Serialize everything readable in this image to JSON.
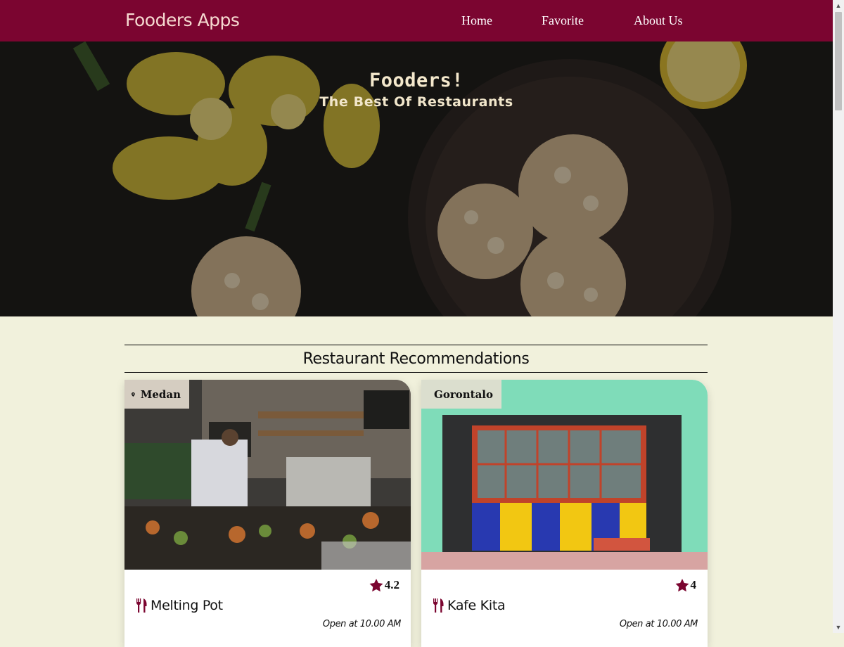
{
  "navbar": {
    "brand": "Fooders Apps",
    "links": [
      {
        "label": "Home"
      },
      {
        "label": "Favorite"
      },
      {
        "label": "About Us"
      }
    ]
  },
  "hero": {
    "title": "Fooders!",
    "subtitle": "The Best Of Restaurants"
  },
  "section": {
    "heading": "Restaurant Recommendations"
  },
  "restaurants": [
    {
      "city": "Medan",
      "rating": "4.2",
      "name": "Melting Pot",
      "open": "Open at 10.00 AM"
    },
    {
      "city": "Gorontalo",
      "rating": "4",
      "name": "Kafe Kita",
      "open": "Open at 10.00 AM"
    }
  ],
  "colors": {
    "brand": "#7b0530",
    "page_background": "#f1f1dc",
    "icon_accent": "#7b0530"
  },
  "icons": {
    "location": "location-pin-icon",
    "rating": "star-icon",
    "restaurant": "fork-knife-icon"
  }
}
